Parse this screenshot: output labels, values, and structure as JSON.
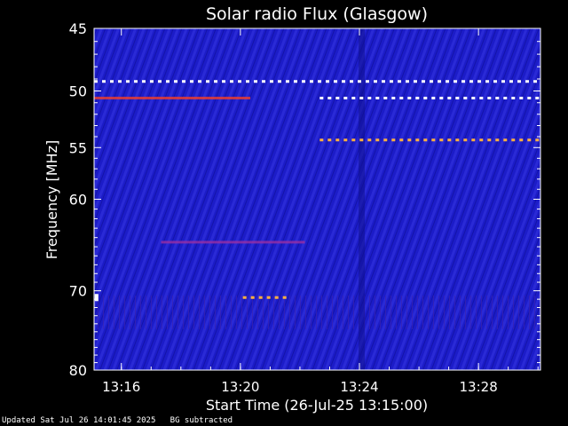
{
  "chart_data": {
    "type": "heatmap",
    "title": "Solar radio Flux (Glasgow)",
    "xlabel": "Start Time (26-Jul-25 13:15:00)",
    "ylabel": "Frequency [MHz]",
    "xlim_minutes": [
      "13:15:05",
      "13:30:05"
    ],
    "ylim_mhz": [
      45,
      80
    ],
    "y_scale": "log",
    "x_ticks": [
      "13:16",
      "13:20",
      "13:24",
      "13:28"
    ],
    "y_ticks": [
      45,
      50,
      55,
      60,
      70,
      80
    ],
    "colormap": "blue-red-yellow-white",
    "background_color": "#1c1cc8",
    "features": [
      {
        "kind": "dashed-band",
        "freq_mhz": 49.2,
        "from": "13:15:05",
        "to": "13:30:05",
        "color": "#ffffff"
      },
      {
        "kind": "band",
        "freq_mhz": 50.6,
        "from": "13:15:05",
        "to": "13:20:20",
        "color": "#ff4020"
      },
      {
        "kind": "dashed-band",
        "freq_mhz": 50.6,
        "from": "13:22:40",
        "to": "13:30:05",
        "color": "#ffffff"
      },
      {
        "kind": "dashed-band",
        "freq_mhz": 54.3,
        "from": "13:22:40",
        "to": "13:30:05",
        "color": "#ffb040"
      },
      {
        "kind": "band",
        "freq_mhz": 64.5,
        "from": "13:17:20",
        "to": "13:22:10",
        "color": "#a030a0"
      },
      {
        "kind": "dashed-band",
        "freq_mhz": 70.8,
        "from": "13:20:05",
        "to": "13:21:35",
        "color": "#ffb040"
      },
      {
        "kind": "spot",
        "freq_mhz": 70.8,
        "time": "13:15:10",
        "color": "#ffffff"
      }
    ]
  },
  "status": {
    "updated": "Updated Sat Jul 26 14:01:45 2025",
    "note": "BG subtracted"
  }
}
